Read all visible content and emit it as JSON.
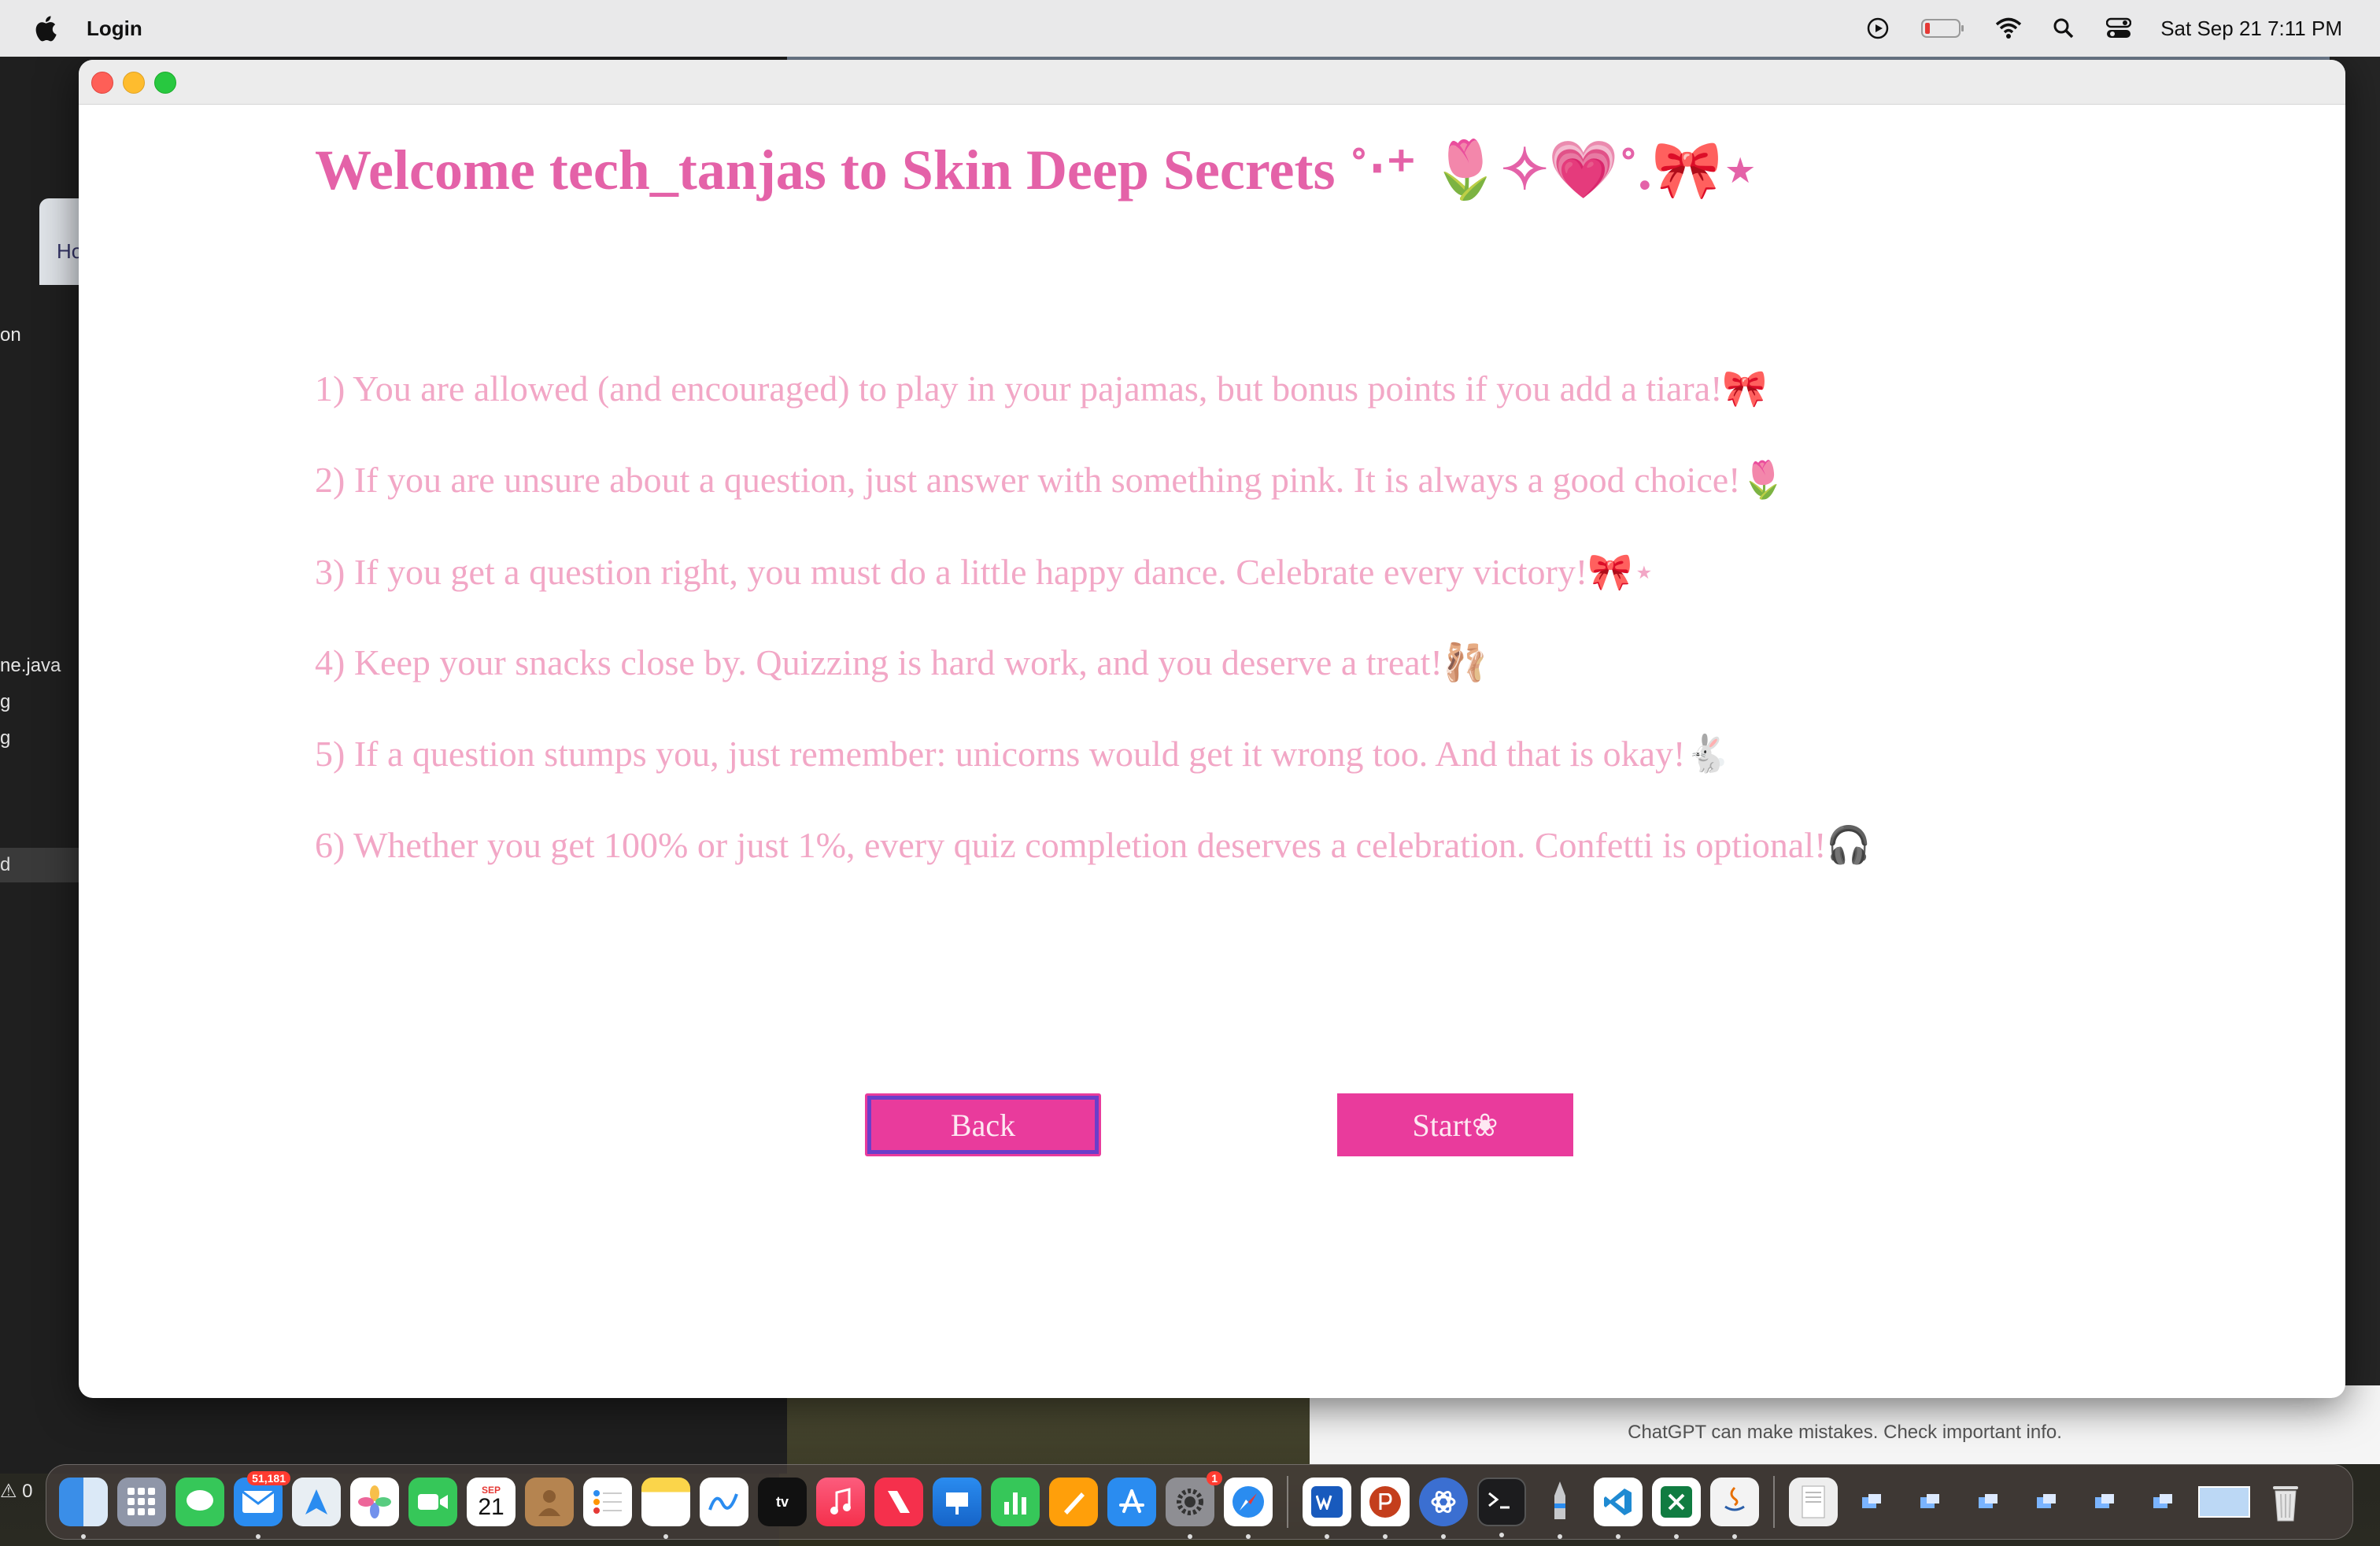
{
  "menubar": {
    "app_name": "Login",
    "clock": "Sat Sep 21  7:11 PM"
  },
  "window": {
    "heading": "Welcome tech_tanjas to Skin Deep Secrets ˚‧⁺ 🌷✧💗˚.🎀⋆",
    "rules": [
      "1) You are allowed (and encouraged) to play in your pajamas, but bonus points if you add a tiara!🎀",
      "2) If you are unsure about a question, just answer with something pink. It is always a good choice!🌷",
      "3) If you get a question right, you must do a little happy dance. Celebrate every victory!🎀⋆",
      "4) Keep your snacks close by. Quizzing is hard work, and you deserve a treat!🩰",
      "5) If a question stumps you, just remember: unicorns would get it wrong too. And that is okay!🐇",
      "6) Whether you get 100% or just 1%, every quiz completion deserves a celebration. Confetti is optional!🎧"
    ],
    "back_label": "Back",
    "start_label": "Start❀"
  },
  "background": {
    "ide_lines": [
      "on",
      "ne.java",
      "g",
      "g",
      "d"
    ],
    "ide_tab": "Ho",
    "chatgpt_note": "ChatGPT can make mistakes. Check important info.",
    "status_left": "⚠ 0"
  },
  "dock": {
    "mail_badge": "51,181",
    "settings_badge": "1",
    "calendar_month": "SEP",
    "calendar_day": "21"
  },
  "colors": {
    "heading": "#e462a8",
    "rule_text": "#f2a7c6",
    "button_bg": "#e93b9c",
    "focus_ring": "#6b3ec9"
  }
}
